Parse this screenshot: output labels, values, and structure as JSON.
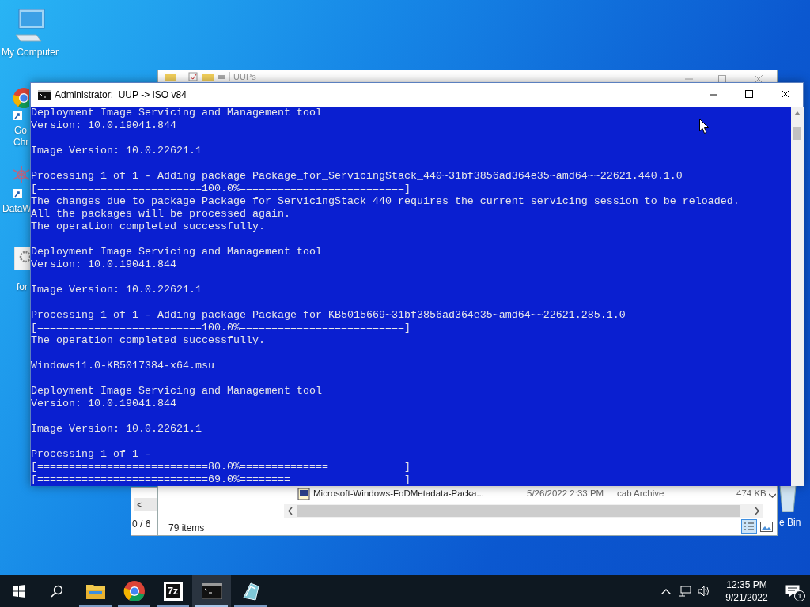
{
  "desktop_icons": [
    {
      "kind": "computer",
      "label": "My Computer"
    },
    {
      "kind": "chrome",
      "label": "Go",
      "label_2": "Chr"
    },
    {
      "kind": "datawrapper",
      "label": "DataW"
    },
    {
      "kind": "settings",
      "label": "for"
    }
  ],
  "explorer_window": {
    "title": "UUPs",
    "file_row": {
      "name": "Microsoft-Windows-FoDMetadata-Packa...",
      "date": "5/26/2022 2:33 PM",
      "type": "cab Archive",
      "size": "474 KB"
    },
    "status": "79 items"
  },
  "back_window": {
    "scroll_arrow": "<",
    "status": "0 / 6"
  },
  "recycle_bin": {
    "label": "e Bin"
  },
  "console": {
    "title": "Administrator:  UUP -> ISO v84",
    "blocks": [
      [
        "Deployment Image Servicing and Management tool",
        "Version: 10.0.19041.844"
      ],
      [
        "Image Version: 10.0.22621.1"
      ],
      [
        "Processing 1 of 1 - Adding package Package_for_ServicingStack_440~31bf3856ad364e35~amd64~~22621.440.1.0",
        "[==========================100.0%==========================]",
        "The changes due to package Package_for_ServicingStack_440 requires the current servicing session to be reloaded.",
        "All the packages will be processed again.",
        "The operation completed successfully."
      ],
      [
        "Deployment Image Servicing and Management tool",
        "Version: 10.0.19041.844"
      ],
      [
        "Image Version: 10.0.22621.1"
      ],
      [
        "Processing 1 of 1 - Adding package Package_for_KB5015669~31bf3856ad364e35~amd64~~22621.285.1.0",
        "[==========================100.0%==========================]",
        "The operation completed successfully."
      ],
      [
        "Windows11.0-KB5017384-x64.msu"
      ],
      [
        "Deployment Image Servicing and Management tool",
        "Version: 10.0.19041.844"
      ],
      [
        "Image Version: 10.0.22621.1"
      ],
      [
        "Processing 1 of 1 -",
        "[===========================80.0%==============            ]",
        "[===========================69.0%========                  ]"
      ]
    ]
  },
  "taskbar": {
    "apps": [
      {
        "kind": "explorer",
        "running": true,
        "active": false
      },
      {
        "kind": "chrome",
        "running": true,
        "active": false
      },
      {
        "kind": "sevenzip",
        "label": "7z",
        "running": true,
        "active": false
      },
      {
        "kind": "console",
        "running": true,
        "active": true
      },
      {
        "kind": "app",
        "running": true,
        "active": false
      }
    ],
    "time": "12:35 PM",
    "date": "9/21/2022",
    "notifications": "1"
  }
}
